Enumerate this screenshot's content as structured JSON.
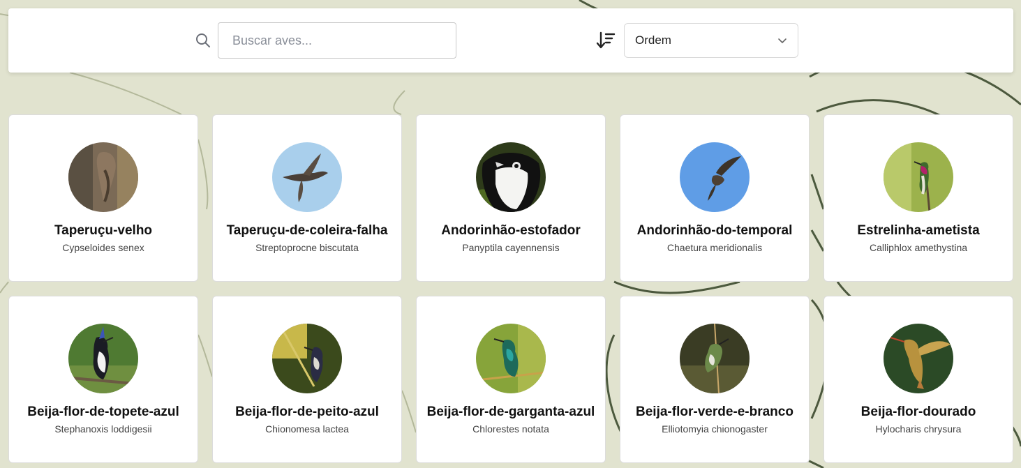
{
  "search": {
    "placeholder": "Buscar aves...",
    "value": ""
  },
  "sort": {
    "selected": "Ordem"
  },
  "birds": [
    {
      "common": "Taperuçu-velho",
      "scientific": "Cypseloides senex"
    },
    {
      "common": "Taperuçu-de-coleira-falha",
      "scientific": "Streptoprocne biscutata"
    },
    {
      "common": "Andorinhão-estofador",
      "scientific": "Panyptila cayennensis"
    },
    {
      "common": "Andorinhão-do-temporal",
      "scientific": "Chaetura meridionalis"
    },
    {
      "common": "Estrelinha-ametista",
      "scientific": "Calliphlox amethystina"
    },
    {
      "common": "Beija-flor-de-topete-azul",
      "scientific": "Stephanoxis loddigesii"
    },
    {
      "common": "Beija-flor-de-peito-azul",
      "scientific": "Chionomesa lactea"
    },
    {
      "common": "Beija-flor-de-garganta-azul",
      "scientific": "Chlorestes notata"
    },
    {
      "common": "Beija-flor-verde-e-branco",
      "scientific": "Elliotomyia chionogaster"
    },
    {
      "common": "Beija-flor-dourado",
      "scientific": "Hylocharis chrysura"
    }
  ],
  "colors": {
    "background": "#e1e3cf",
    "leaf_outline": "#3c4a2e",
    "card": "#ffffff"
  },
  "icons": [
    "search-icon",
    "sort-descending-icon",
    "chevron-down-icon"
  ]
}
